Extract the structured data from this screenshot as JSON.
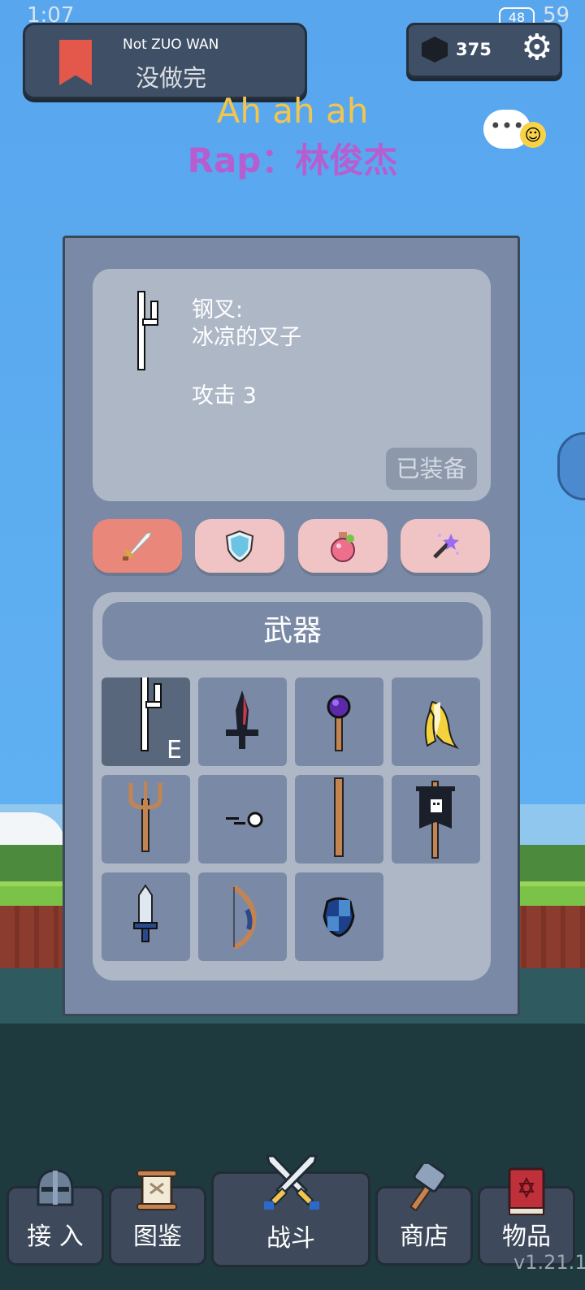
{
  "status_bar": {
    "time": "1:07",
    "battery": "48",
    "right_text": "59"
  },
  "quest": {
    "title": "Not ZUO WAN",
    "subtitle": "没做完",
    "icon": "bookmark-icon"
  },
  "currency": {
    "icon": "gem-icon",
    "count": "375",
    "settings_icon": "gear-icon"
  },
  "lyrics": {
    "line1": "Ah ah ah",
    "line2": "Rap：林俊杰"
  },
  "chat": {
    "icon": "chat-bubble-icon",
    "dots": "•••"
  },
  "item_card": {
    "name": "钢叉:",
    "description": "冰凉的叉子",
    "stat": "攻击  3",
    "status_button": "已装备"
  },
  "categories": [
    {
      "name": "sword",
      "icon": "sword-icon",
      "color": "#e9877a",
      "selected": true
    },
    {
      "name": "shield",
      "icon": "shield-icon",
      "color": "#f0c4c4",
      "selected": false
    },
    {
      "name": "potion",
      "icon": "potion-icon",
      "color": "#f0c4c4",
      "selected": false
    },
    {
      "name": "magic",
      "icon": "magic-wand-icon",
      "color": "#f0c4c4",
      "selected": false
    }
  ],
  "inventory": {
    "title": "武器",
    "equipped_marker": "E",
    "items": [
      {
        "icon": "steel-fork-icon",
        "equipped": true
      },
      {
        "icon": "dark-dagger-icon"
      },
      {
        "icon": "purple-staff-icon"
      },
      {
        "icon": "banana-icon"
      },
      {
        "icon": "trident-icon"
      },
      {
        "icon": "pellet-icon"
      },
      {
        "icon": "wooden-stick-icon"
      },
      {
        "icon": "banner-flag-icon"
      },
      {
        "icon": "short-sword-icon"
      },
      {
        "icon": "bow-icon"
      },
      {
        "icon": "round-shield-icon"
      }
    ]
  },
  "nav": [
    {
      "label": "接 入",
      "icon": "helmet-icon"
    },
    {
      "label": "图鉴",
      "icon": "scroll-icon"
    },
    {
      "label": "战斗",
      "icon": "crossed-swords-icon",
      "active": true
    },
    {
      "label": "商店",
      "icon": "hammer-icon"
    },
    {
      "label": "物品",
      "icon": "spellbook-icon"
    }
  ],
  "version": "v1.21.1"
}
